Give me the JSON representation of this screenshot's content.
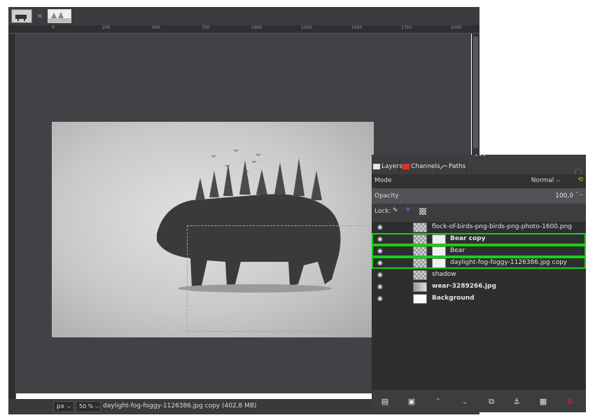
{
  "tabs": {
    "close_glyph": "×"
  },
  "ruler": {
    "ticks": [
      "0",
      "250",
      "500",
      "750",
      "1000",
      "1250",
      "1500",
      "1750",
      "2000"
    ]
  },
  "statusbar": {
    "unit": "px",
    "zoom": "50 %",
    "text": "daylight-fog-foggy-1126386.jpg copy (402,8 MB)"
  },
  "dock": {
    "tabs": [
      {
        "label": "Layers",
        "icon": "layers-icon"
      },
      {
        "label": "Channels",
        "icon": "channels-icon"
      },
      {
        "label": "Paths",
        "icon": "paths-icon"
      }
    ],
    "mode_label": "Mode",
    "mode_value": "Normal",
    "opacity_label": "Opacity",
    "opacity_value": "100,0",
    "lock_label": "Lock:",
    "layers": [
      {
        "name": "flock-of-birds-png-birds-png-photo-1600.png",
        "bold": false,
        "has_mask": false,
        "highlighted": false
      },
      {
        "name": "Bear copy",
        "bold": true,
        "has_mask": true,
        "highlighted": true
      },
      {
        "name": "Bear",
        "bold": false,
        "has_mask": true,
        "highlighted": true
      },
      {
        "name": "daylight-fog-foggy-1126386.jpg copy",
        "bold": false,
        "has_mask": true,
        "highlighted": true
      },
      {
        "name": "shadow",
        "bold": false,
        "has_mask": false,
        "highlighted": false
      },
      {
        "name": "wear-3289266.jpg",
        "bold": true,
        "has_mask": false,
        "highlighted": false
      },
      {
        "name": "Background",
        "bold": true,
        "has_mask": false,
        "highlighted": false
      }
    ],
    "footer_icons": [
      "new-layer-icon",
      "new-group-icon",
      "raise-layer-icon",
      "lower-layer-icon",
      "duplicate-layer-icon",
      "anchor-layer-icon",
      "merge-down-icon",
      "delete-layer-icon"
    ]
  },
  "colors": {
    "highlight": "#17d117",
    "accent_orange": "#f0a000",
    "delete_red": "#e02020"
  }
}
